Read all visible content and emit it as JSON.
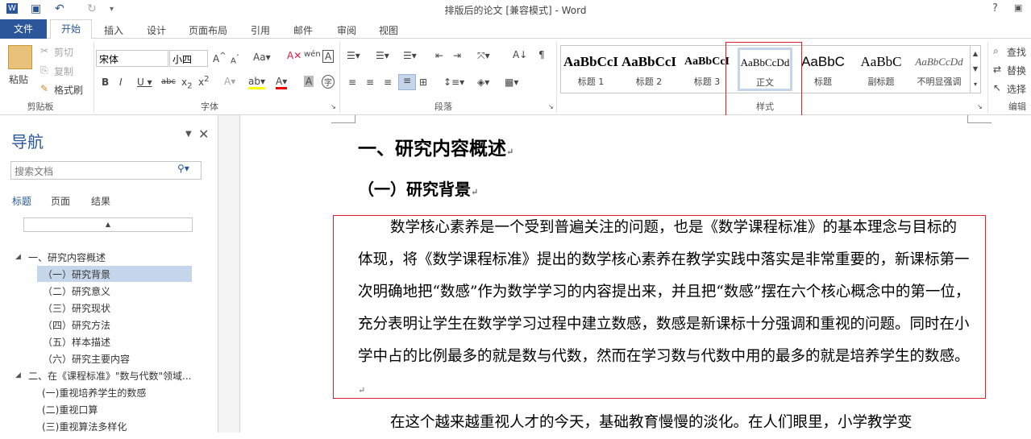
{
  "window": {
    "title": "排版后的论文 [兼容模式] - Word",
    "help": "?"
  },
  "tabs": [
    "开始",
    "插入",
    "设计",
    "页面布局",
    "引用",
    "邮件",
    "审阅",
    "视图"
  ],
  "file_tab": "文件",
  "clipboard": {
    "paste": "粘贴",
    "cut": "剪切",
    "copy": "复制",
    "format_painter": "格式刷",
    "group": "剪贴板"
  },
  "font": {
    "name": "宋体",
    "size": "小四",
    "group": "字体"
  },
  "paragraph": {
    "group": "段落"
  },
  "styles": {
    "group": "样式",
    "items": [
      {
        "preview": "AaBbCcI",
        "name": "标题 1"
      },
      {
        "preview": "AaBbCcI",
        "name": "标题 2"
      },
      {
        "preview": "AaBbCcI",
        "name": "标题 3"
      },
      {
        "preview": "AaBbCcDd",
        "name": "正文"
      },
      {
        "preview": "AaBbC",
        "name": "标题"
      },
      {
        "preview": "AaBbC",
        "name": "副标题"
      },
      {
        "preview": "AaBbCcDd",
        "name": "不明显强调"
      }
    ]
  },
  "editing": {
    "find": "查找",
    "replace": "替换",
    "select": "选择",
    "group": "编辑"
  },
  "nav": {
    "title": "导航",
    "search_placeholder": "搜索文档",
    "tabs": [
      "标题",
      "页面",
      "结果"
    ],
    "items": [
      {
        "text": "一、研究内容概述",
        "level": 1
      },
      {
        "text": "（一）研究背景",
        "level": 2,
        "selected": true
      },
      {
        "text": "（二）研究意义",
        "level": 2
      },
      {
        "text": "（三）研究现状",
        "level": 2
      },
      {
        "text": "（四）研究方法",
        "level": 2
      },
      {
        "text": "（五）样本描述",
        "level": 2
      },
      {
        "text": "（六）研究主要内容",
        "level": 2
      },
      {
        "text": "二、在《课程标准》\"数与代数\"领域...",
        "level": 1
      },
      {
        "text": "(一)重视培养学生的数感",
        "level": 3
      },
      {
        "text": "(二)重视口算",
        "level": 3
      },
      {
        "text": "(三)重视算法多样化",
        "level": 3
      }
    ]
  },
  "document": {
    "h1": "一、研究内容概述",
    "h2": "（一）研究背景",
    "para1": "数学核心素养是一个受到普遍关注的问题，也是《数学课程标准》的基本理念与目标的体现，将《数学课程标准》提出的数学核心素养在教学实践中落实是非常重要的，新课标第一次明确地把“数感”作为数学学习的内容提出来，并且把“数感”摆在六个核心概念中的第一位，充分表明让学生在数学学习过程中建立数感，数感是新课标十分强调和重视的问题。同时在小学中占的比例最多的就是数与代数，然而在学习数与代数中用的最多的就是培养学生的数感。",
    "para2": "在这个越来越重视人才的今天，基础教育慢慢的淡化。在人们眼里，小学教学变"
  },
  "colors": {
    "accent": "#2b579a",
    "highlight_box": "#e0212a"
  }
}
